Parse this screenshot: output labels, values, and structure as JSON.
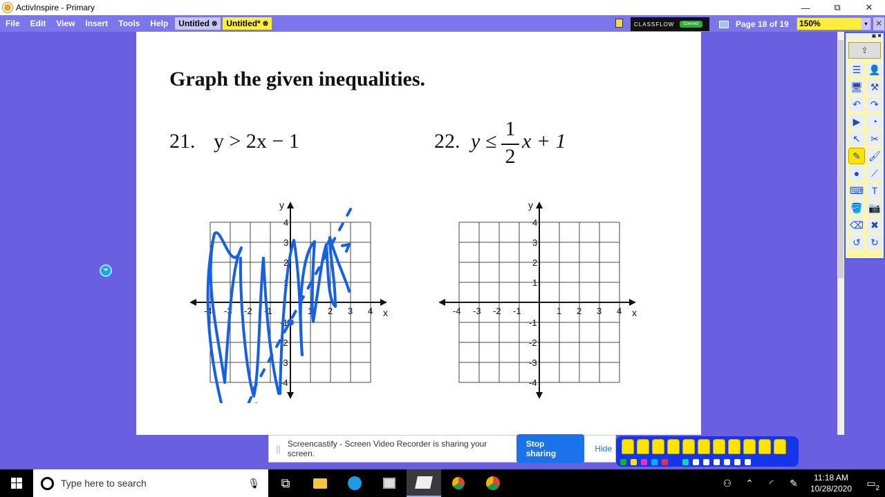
{
  "window": {
    "title": "ActivInspire - Primary",
    "minimize": "—",
    "restore": "⧉",
    "close": "✕"
  },
  "menu": {
    "items": [
      "File",
      "Edit",
      "View",
      "Insert",
      "Tools",
      "Help"
    ]
  },
  "tabs": [
    {
      "label": "Untitled",
      "close": "⊗"
    },
    {
      "label": "Untitled*",
      "close": "⊗"
    }
  ],
  "classflow": {
    "brand": "CLASSFLOW",
    "connect": "Connect"
  },
  "page_info": {
    "label": "Page 18 of 19",
    "zoom": "150%",
    "dropdown": "▾",
    "close": "✕"
  },
  "flipchart": {
    "title": "Graph the given inequalities.",
    "problem21": {
      "number": "21.",
      "expression": "y > 2x − 1"
    },
    "problem22": {
      "number": "22.",
      "prefix": "y ≤",
      "numerator": "1",
      "denominator": "2",
      "suffix": "x + 1"
    },
    "axis": {
      "x_label": "x",
      "y_label": "y",
      "x_ticks": [
        "-4",
        "-3",
        "-2",
        "-1",
        "1",
        "2",
        "3",
        "4"
      ],
      "y_ticks": [
        "4",
        "3",
        "2",
        "1",
        "-1",
        "-2",
        "-3",
        "-4"
      ]
    }
  },
  "toolbox": {
    "header": "▣ ✖",
    "top_icon": "⇪",
    "icons": [
      "page-browser-icon",
      "notebook-icon",
      "screen-icon",
      "settings-icon",
      "undo-page-icon",
      "redo-page-icon",
      "play-icon",
      "clock-icon",
      "select-icon",
      "tools-icon",
      "pen-icon",
      "brush-icon",
      "shape-icon",
      "connector-icon",
      "text-box-icon",
      "text-icon",
      "fill-icon",
      "camera-icon",
      "eraser-icon",
      "delete-icon",
      "undo-icon",
      "redo-icon"
    ],
    "glyphs": [
      "☰",
      "👤",
      "🖥",
      "⚒",
      "↶",
      "↷",
      "▶",
      "◔",
      "↖",
      "✂",
      "✎",
      "🖌",
      "●",
      "⟋",
      "⌨",
      "T",
      "🪣",
      "📷",
      "⌫",
      "✖",
      "↺",
      "↻"
    ]
  },
  "sharing": {
    "message": "Screencastify - Screen Video Recorder is sharing your screen.",
    "stop": "Stop sharing",
    "hide": "Hide"
  },
  "taskbar": {
    "search_placeholder": "Type here to search",
    "time": "11:18 AM",
    "date": "10/28/2020",
    "notifications": "2"
  },
  "colors": {
    "accent": "#6a5fe0",
    "ink": "#1560e8",
    "toolbar": "#1535e8"
  }
}
